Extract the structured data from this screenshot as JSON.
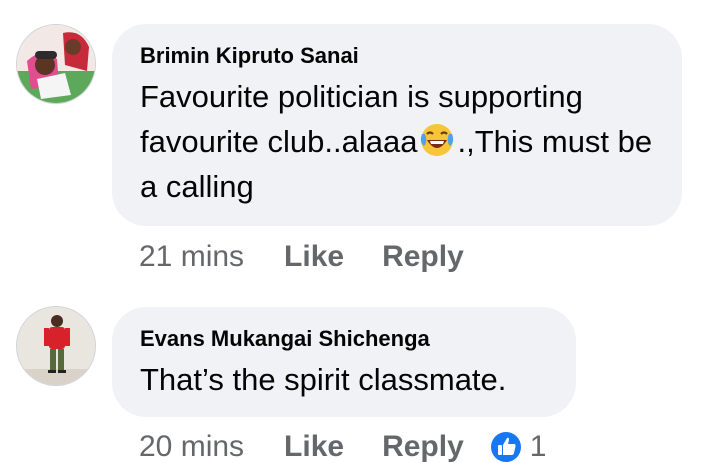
{
  "comments": [
    {
      "author": "Brimin Kipruto Sanai",
      "text_before_emoji": "Favourite politician is supporting favourite club..alaaa",
      "emoji": "laughing-tears-emoji",
      "text_after_emoji": ".,This must be a calling",
      "time": "21 mins",
      "like_label": "Like",
      "reply_label": "Reply"
    },
    {
      "author": "Evans Mukangai Shichenga",
      "text": "That’s the spirit classmate.",
      "time": "20 mins",
      "like_label": "Like",
      "reply_label": "Reply",
      "reaction_icon": "thumbs-up-icon",
      "reaction_count": "1"
    }
  ],
  "colors": {
    "bubble": "#f0f2f5",
    "secondary_text": "#65676b",
    "like_blue": "#1877f2"
  }
}
